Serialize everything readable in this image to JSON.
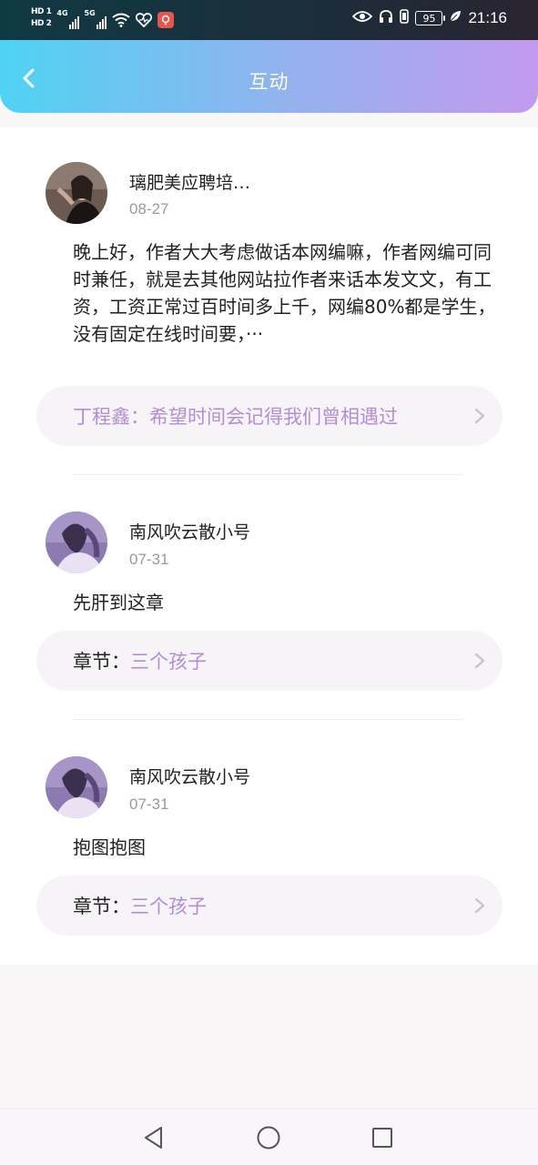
{
  "status_bar": {
    "hd1": "HD 1",
    "hd2": "HD 2",
    "net1": "4G",
    "net2": "5G",
    "battery": "95",
    "time": "21:16",
    "icons": [
      "signal-icon",
      "wifi-icon",
      "heart-icon",
      "app-notification-icon",
      "eye-icon",
      "headphones-icon",
      "vibrate-icon",
      "leaf-icon"
    ],
    "colors": {
      "status_bg": "#1c2d3a"
    }
  },
  "header": {
    "title": "互动",
    "back_icon": "chevron-left-icon",
    "colors": {
      "gradient_start": "#4fd3f4",
      "gradient_end": "#c39aee"
    }
  },
  "posts": [
    {
      "username": "璃肥美应聘培…",
      "date": "08-27",
      "content": "晚上好，作者大大考虑做话本网编嘛，作者网编可同时兼任，就是去其他网站拉作者来话本发文文，有工资，工资正常过百时间多上千，网编80%都是学生，没有固定在线时间要，···",
      "reply_label": "丁程鑫：",
      "reply_text": "希望时间会记得我们曾相遇过"
    },
    {
      "username": "南风吹云散小号",
      "date": "07-31",
      "content": "先肝到这章",
      "chapter_label": "章节：",
      "chapter_name": "三个孩子"
    },
    {
      "username": "南风吹云散小号",
      "date": "07-31",
      "content": "抱图抱图",
      "chapter_label": "章节：",
      "chapter_name": "三个孩子"
    }
  ],
  "accent_color": "#b48ed3",
  "system_nav": {
    "icons": [
      "back-triangle-icon",
      "home-circle-icon",
      "recents-square-icon"
    ]
  }
}
